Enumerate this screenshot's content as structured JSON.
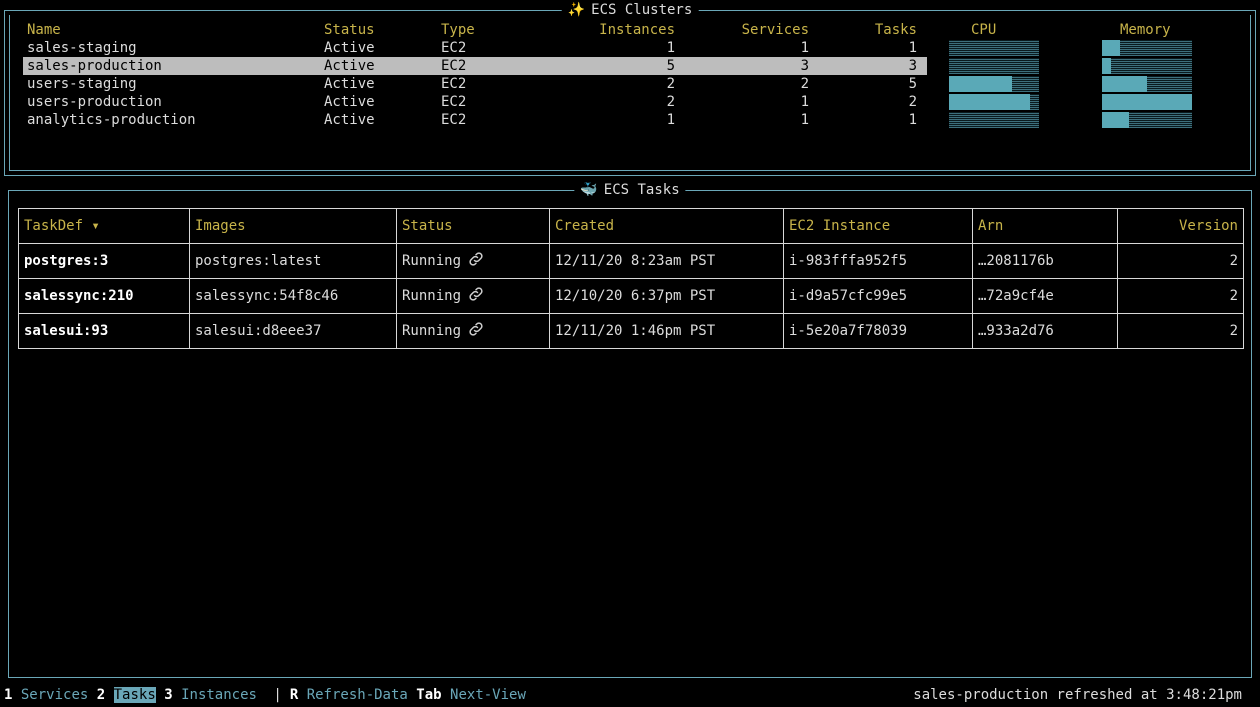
{
  "clusters": {
    "title": "ECS Clusters",
    "icon": "sparkles-icon",
    "headers": {
      "name": "Name",
      "status": "Status",
      "type": "Type",
      "instances": "Instances",
      "services": "Services",
      "tasks": "Tasks",
      "cpu": "CPU",
      "memory": "Memory"
    },
    "rows": [
      {
        "name": "sales-staging",
        "status": "Active",
        "type": "EC2",
        "instances": "1",
        "services": "1",
        "tasks": "1",
        "cpu": 0.0,
        "memory": 0.2
      },
      {
        "name": "sales-production",
        "status": "Active",
        "type": "EC2",
        "instances": "5",
        "services": "3",
        "tasks": "3",
        "cpu": 0.0,
        "memory": 0.1
      },
      {
        "name": "users-staging",
        "status": "Active",
        "type": "EC2",
        "instances": "2",
        "services": "2",
        "tasks": "5",
        "cpu": 0.7,
        "memory": 0.5
      },
      {
        "name": "users-production",
        "status": "Active",
        "type": "EC2",
        "instances": "2",
        "services": "1",
        "tasks": "2",
        "cpu": 0.9,
        "memory": 1.0
      },
      {
        "name": "analytics-production",
        "status": "Active",
        "type": "EC2",
        "instances": "1",
        "services": "1",
        "tasks": "1",
        "cpu": 0.0,
        "memory": 0.3
      }
    ],
    "selected_index": 1
  },
  "tasks": {
    "title": "ECS Tasks",
    "icon": "whale-icon",
    "headers": {
      "taskdef": "TaskDef ▾",
      "images": "Images",
      "status": "Status",
      "created": "Created",
      "ec2": "EC2 Instance",
      "arn": "Arn",
      "version": "Version"
    },
    "rows": [
      {
        "taskdef": "postgres:3",
        "image": "postgres:latest",
        "status": "Running",
        "created": "12/11/20 8:23am PST",
        "ec2": "i-983fffa952f5",
        "arn": "…2081176b",
        "version": "2"
      },
      {
        "taskdef": "salessync:210",
        "image": "salessync:54f8c46",
        "status": "Running",
        "created": "12/10/20 6:37pm PST",
        "ec2": "i-d9a57cfc99e5",
        "arn": "…72a9cf4e",
        "version": "2"
      },
      {
        "taskdef": "salesui:93",
        "image": "salesui:d8eee37",
        "status": "Running",
        "created": "12/11/20 1:46pm PST",
        "ec2": "i-5e20a7f78039",
        "arn": "…933a2d76",
        "version": "2"
      }
    ]
  },
  "footer": {
    "k1": "1",
    "services": "Services",
    "k2": "2",
    "tasks": "Tasks",
    "k3": "3",
    "instances": "Instances",
    "sep": "|",
    "kr": "R",
    "refresh": "Refresh-Data",
    "ktab": "Tab",
    "next": "Next-View",
    "status_message": "sales-production refreshed at 3:48:21pm"
  },
  "colors": {
    "border": "#6aa7b8",
    "header_text": "#c8b44a",
    "gauge_fill": "#5aa9b7",
    "selected_bg": "#bdbdbd"
  }
}
